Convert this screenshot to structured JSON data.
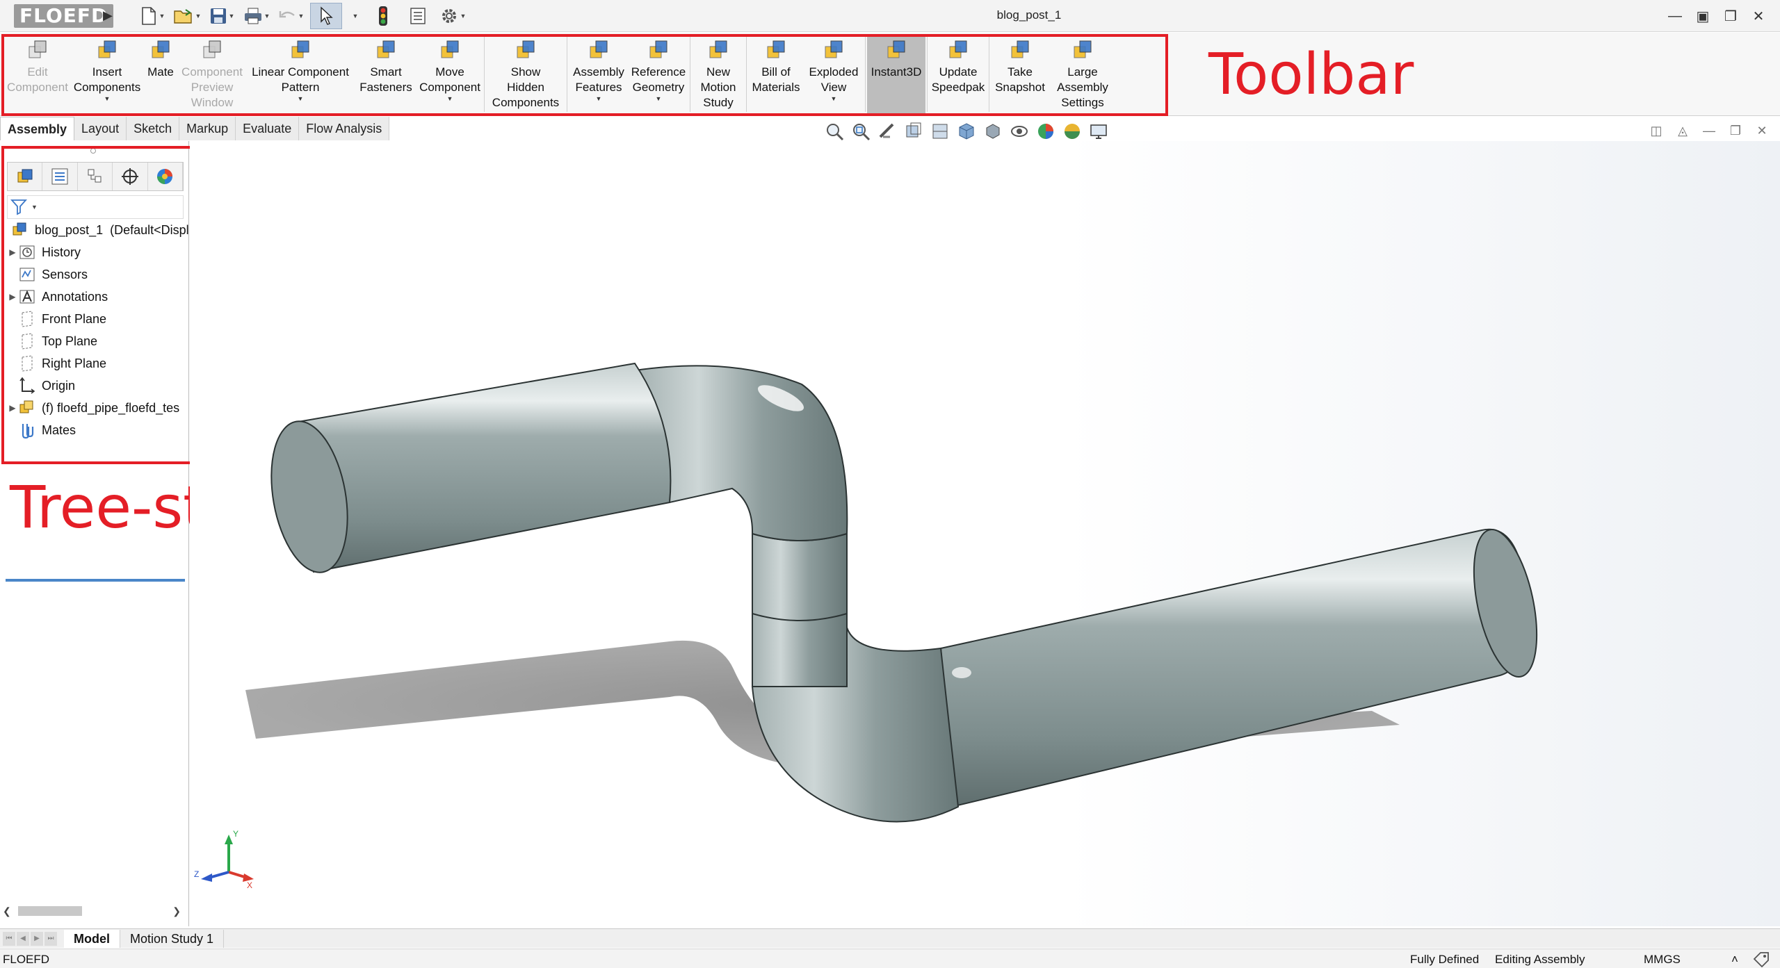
{
  "app": {
    "logo": "FLOEFD",
    "document_title": "blog_post_1"
  },
  "ribbon": {
    "buttons": [
      {
        "id": "edit-component",
        "lines": [
          "Edit",
          "Component"
        ],
        "disabled": true
      },
      {
        "id": "insert-components",
        "lines": [
          "Insert",
          "Components"
        ],
        "dropdown": true
      },
      {
        "id": "mate",
        "lines": [
          "Mate"
        ]
      },
      {
        "id": "component-preview-window",
        "lines": [
          "Component",
          "Preview",
          "Window"
        ],
        "disabled": true
      },
      {
        "id": "linear-component-pattern",
        "lines": [
          "Linear Component",
          "Pattern"
        ],
        "dropdown": true
      },
      {
        "id": "smart-fasteners",
        "lines": [
          "Smart",
          "Fasteners"
        ]
      },
      {
        "id": "move-component",
        "lines": [
          "Move",
          "Component"
        ],
        "dropdown": true
      },
      {
        "id": "show-hidden-components",
        "lines": [
          "Show",
          "Hidden",
          "Components"
        ]
      },
      {
        "id": "assembly-features",
        "lines": [
          "Assembly",
          "Features"
        ],
        "dropdown": true
      },
      {
        "id": "reference-geometry",
        "lines": [
          "Reference",
          "Geometry"
        ],
        "dropdown": true
      },
      {
        "id": "new-motion-study",
        "lines": [
          "New",
          "Motion",
          "Study"
        ]
      },
      {
        "id": "bill-of-materials",
        "lines": [
          "Bill of",
          "Materials"
        ]
      },
      {
        "id": "exploded-view",
        "lines": [
          "Exploded",
          "View"
        ],
        "dropdown": true
      },
      {
        "id": "instant3d",
        "lines": [
          "Instant3D"
        ],
        "active": true
      },
      {
        "id": "update-speedpak",
        "lines": [
          "Update",
          "Speedpak"
        ]
      },
      {
        "id": "take-snapshot",
        "lines": [
          "Take",
          "Snapshot"
        ]
      },
      {
        "id": "large-assembly-settings",
        "lines": [
          "Large",
          "Assembly",
          "Settings"
        ]
      }
    ]
  },
  "annotations": {
    "toolbar": "Toolbar",
    "tree": "Tree-structure"
  },
  "command_tabs": [
    "Assembly",
    "Layout",
    "Sketch",
    "Markup",
    "Evaluate",
    "Flow Analysis"
  ],
  "tree": {
    "root": {
      "name": "blog_post_1",
      "config": "(Default<Displa"
    },
    "items": [
      {
        "label": "History",
        "icon": "history-icon",
        "expandable": true
      },
      {
        "label": "Sensors",
        "icon": "sensors-icon",
        "expandable": false
      },
      {
        "label": "Annotations",
        "icon": "annotations-icon",
        "expandable": true
      },
      {
        "label": "Front Plane",
        "icon": "plane-icon",
        "expandable": false
      },
      {
        "label": "Top Plane",
        "icon": "plane-icon",
        "expandable": false
      },
      {
        "label": "Right Plane",
        "icon": "plane-icon",
        "expandable": false
      },
      {
        "label": "Origin",
        "icon": "origin-icon",
        "expandable": false
      },
      {
        "label": "(f) floefd_pipe_floefd_tes",
        "icon": "part-icon",
        "expandable": true
      },
      {
        "label": "Mates",
        "icon": "mates-icon",
        "expandable": false
      }
    ]
  },
  "triad": {
    "x": "X",
    "y": "Y",
    "z": "Z"
  },
  "bottom_tabs": [
    "Model",
    "Motion Study 1"
  ],
  "status": {
    "left": "FLOEFD",
    "defined": "Fully Defined",
    "mode": "Editing Assembly",
    "units": "MMGS",
    "units_arrow": "˄"
  },
  "colors": {
    "annotation_red": "#e41e26",
    "pipe": "#8d9c9c",
    "tree_accent": "#4a86c8"
  }
}
